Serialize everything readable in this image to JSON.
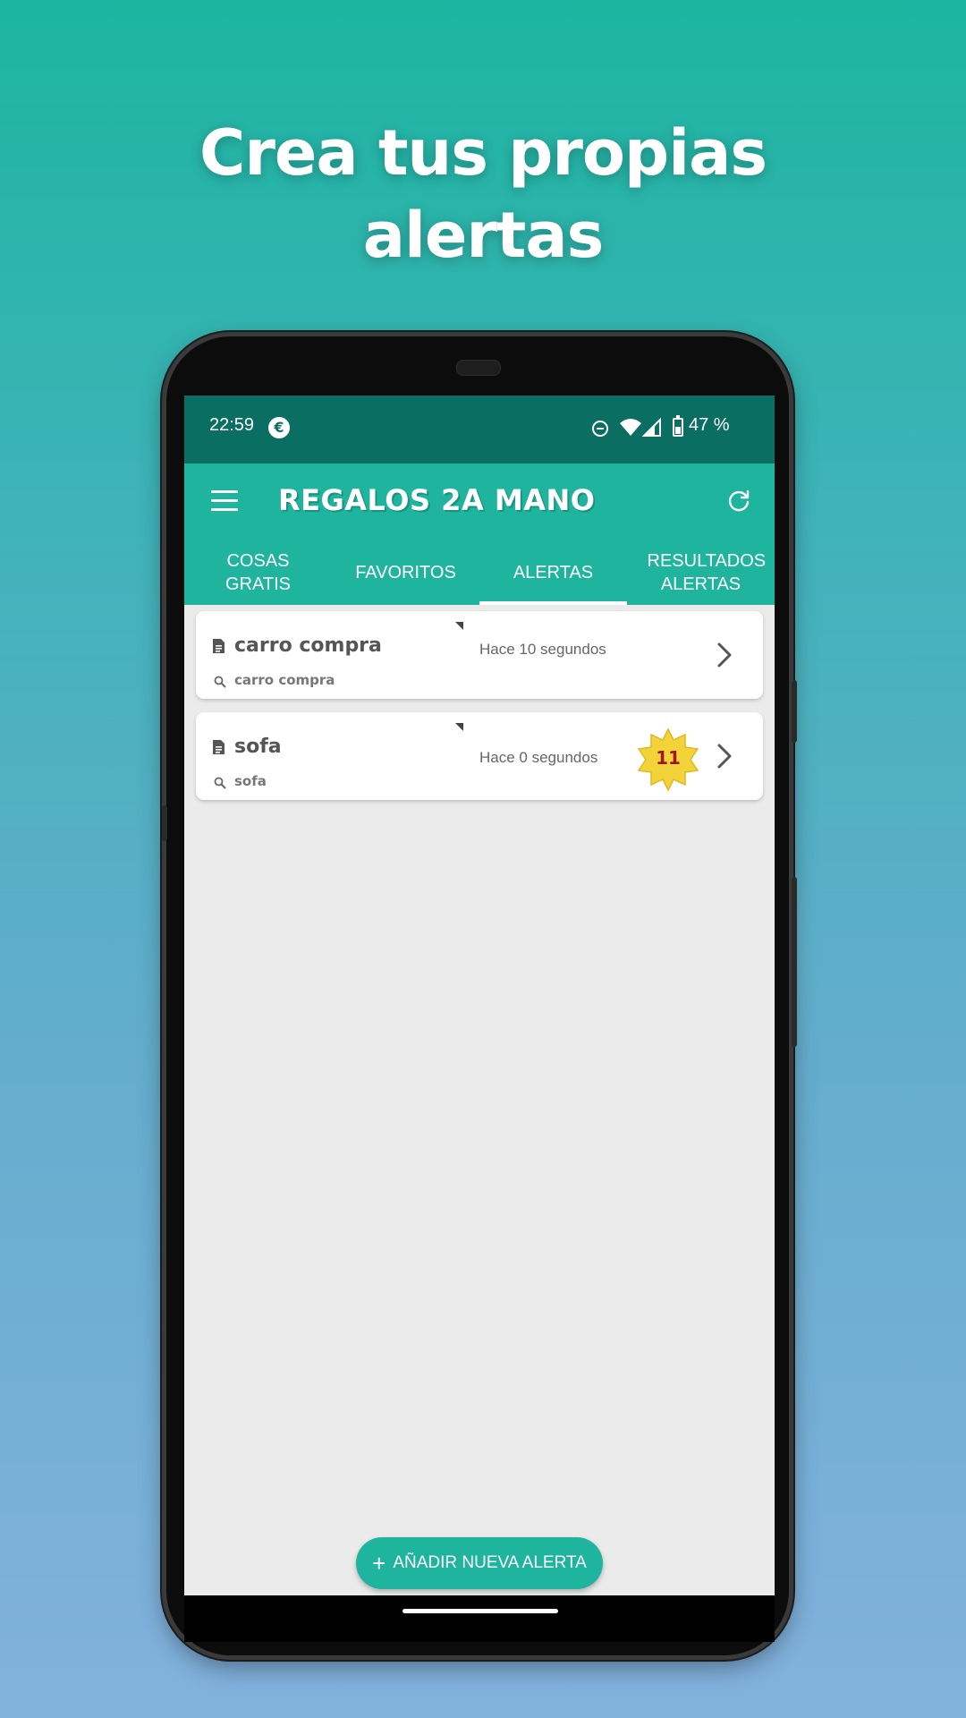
{
  "promo": {
    "line1": "Crea tus propias",
    "line2": "alertas"
  },
  "status_bar": {
    "time": "22:59",
    "currency_icon": "€",
    "battery": "47 %"
  },
  "app_bar": {
    "title": "REGALOS 2A MANO"
  },
  "tabs": [
    {
      "label": "COSAS GRATIS"
    },
    {
      "label": "FAVORITOS"
    },
    {
      "label": "ALERTAS"
    },
    {
      "label": "RESULTADOS ALERTAS"
    }
  ],
  "active_tab": "ALERTAS",
  "alerts": [
    {
      "name": "carro compra",
      "query": "carro compra",
      "time": "Hace 10 segundos"
    },
    {
      "name": "sofa",
      "query": "sofa",
      "time": "Hace 0 segundos",
      "badge": "11"
    }
  ],
  "fab": {
    "plus": "+",
    "label": "AÑADIR NUEVA ALERTA"
  },
  "colors": {
    "primary": "#1eb49e",
    "status_bar": "#0a6e62",
    "badge": "#f2d43a",
    "badge_text": "#a01818"
  }
}
